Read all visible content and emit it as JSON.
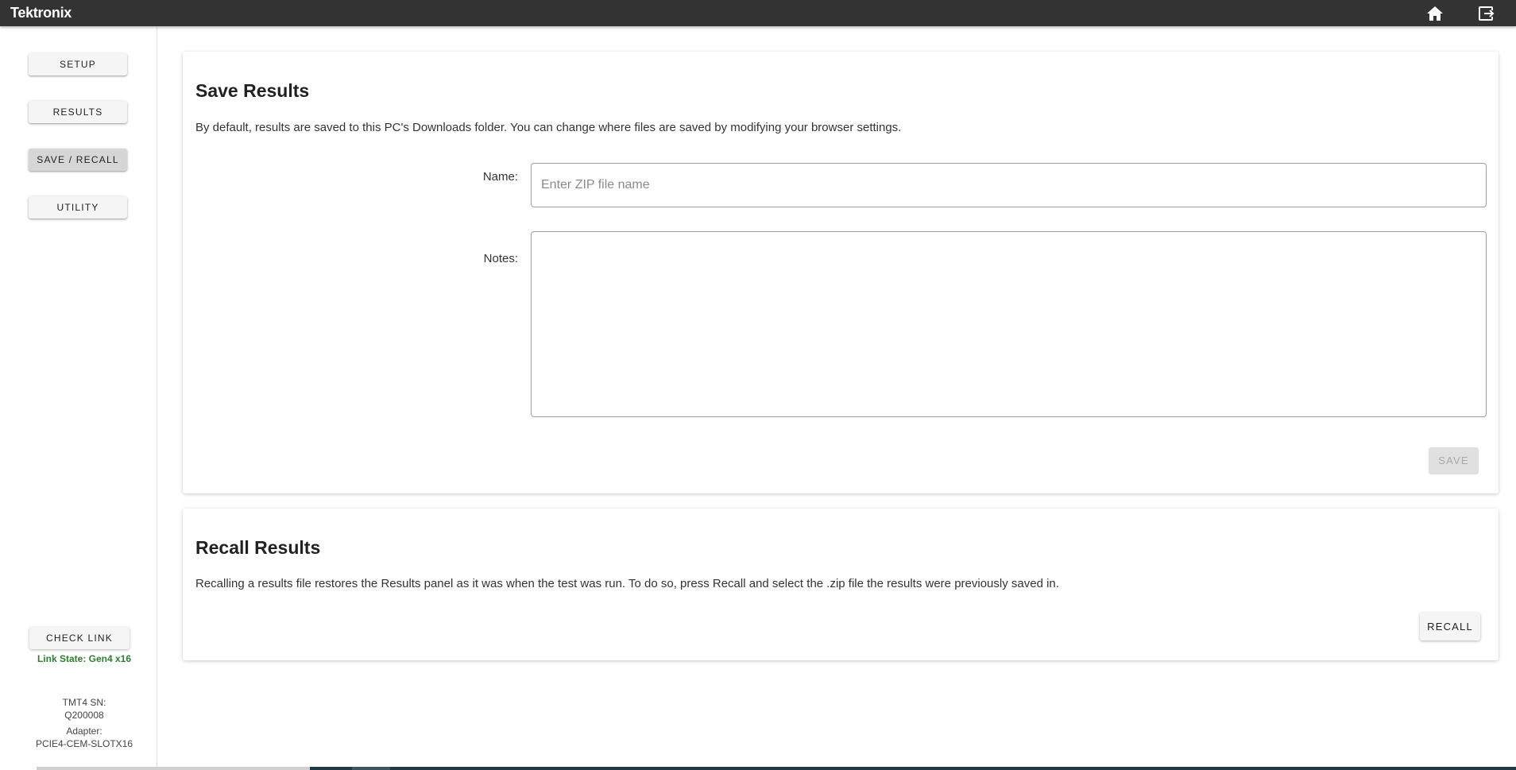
{
  "header": {
    "logo_text": "Tektronix",
    "icons": [
      "home-icon",
      "exit-icon"
    ]
  },
  "sidebar": {
    "items": [
      {
        "label": "SETUP"
      },
      {
        "label": "RESULTS"
      },
      {
        "label": "SAVE / RECALL",
        "active": true
      },
      {
        "label": "UTILITY"
      }
    ],
    "check_link_label": "CHECK LINK",
    "link_state": "Link State: Gen4 x16",
    "sn_label": "TMT4 SN:",
    "sn_value": "Q200008",
    "adapter_label": "Adapter:",
    "adapter_value": "PCIE4-CEM-SLOTX16"
  },
  "save": {
    "title": "Save Results",
    "description": "By default, results are saved to this PC's Downloads folder. You can change where files are saved by modifying your browser settings.",
    "name_label": "Name:",
    "name_placeholder": "Enter ZIP file name",
    "name_value": "",
    "notes_label": "Notes:",
    "notes_value": "",
    "save_label": "SAVE",
    "save_enabled": false
  },
  "recall": {
    "title": "Recall Results",
    "description": "Recalling a results file restores the Results panel as it was when the test was run. To do so, press Recall and select the .zip file the results were previously saved in.",
    "recall_label": "RECALL"
  },
  "colors": {
    "topbar": "#333333",
    "link_state_green": "#2e7d32",
    "active_nav": "#d6d6d6"
  }
}
